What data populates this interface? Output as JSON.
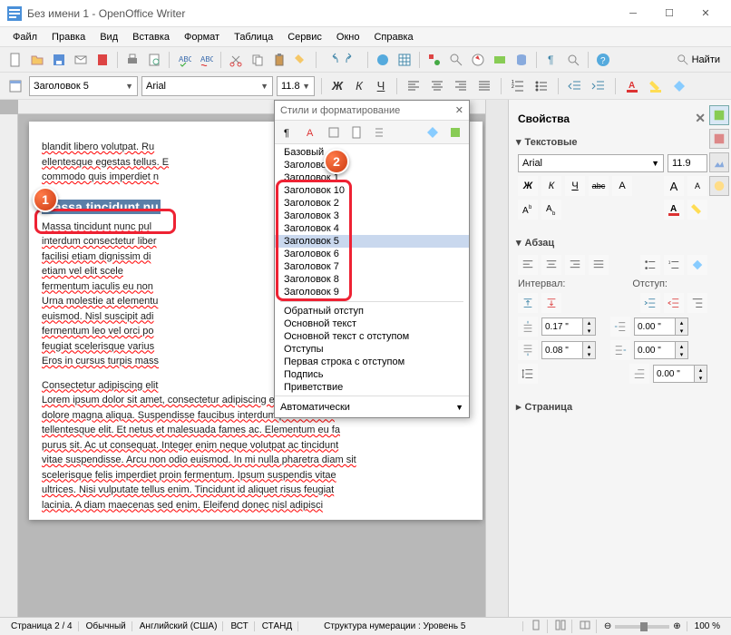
{
  "window": {
    "title": "Без имени 1 - OpenOffice Writer"
  },
  "menu": [
    "Файл",
    "Правка",
    "Вид",
    "Вставка",
    "Формат",
    "Таблица",
    "Сервис",
    "Окно",
    "Справка"
  ],
  "toolbar_find": "Найти",
  "formatbar": {
    "style": "Заголовок 5",
    "font": "Arial",
    "size": "11.8",
    "bold": "Ж",
    "italic": "К",
    "underline": "Ч"
  },
  "document": {
    "para1": "blandit libero volutpat. Ru",
    "para1b": "ellentesque egestas tellus. E",
    "para1c": "commodo quis imperdiet n",
    "heading_selected": "Massa tincidunt nu",
    "para2a": "Massa tincidunt nunc pul",
    "para2b": "interdum consectetur liber",
    "para2c": "facilisi etiam dignissim di",
    "para2d": "etiam vel elit scele",
    "para2e": "fermentum iaculis eu non",
    "para2f": "Urna molestie at elementu",
    "para2g": "euismod. Nisl suscipit adi",
    "para2h": "fermentum leo vel orci po",
    "para2i": "feugiat scelerisque varius",
    "para2j": "Eros in cursus turpis mass",
    "para3a": "Consectetur adipiscing elit",
    "para3b": "Lorem ipsum dolor sit amet, consectetur adipiscing elit, sed do elit",
    "para3c": "dolore magna aliqua. Suspendisse faucibus interdum posuere lore",
    "para3d": "tellentesque elit. Et netus et malesuada fames ac. Elementum eu fa",
    "para3e": "purus sit. Ac ut consequat. Integer enim neque volutpat ac tincidunt",
    "para3f": "vitae suspendisse. Arcu non odio euismod. In mi nulla pharetra diam sit",
    "para3g": "scelerisque felis imperdiet proin fermentum. Ipsum suspendis vitae",
    "para3h": "ultrices. Nisi vulputate tellus enim. Tincidunt id aliquet risus feugiat",
    "para3i": "lacinia. A diam maecenas sed enim. Eleifend donec nisl adipisci"
  },
  "styles_panel": {
    "title": "Стили и форматирование",
    "items_top": [
      "Базовый",
      "Заголовок",
      "Заголовок 1"
    ],
    "items_boxed": [
      "Заголовок 10",
      "Заголовок 2",
      "Заголовок 3",
      "Заголовок 4",
      "Заголовок 5",
      "Заголовок 6",
      "Заголовок 7",
      "Заголовок 8",
      "Заголовок 9"
    ],
    "selected_index": 4,
    "items_bottom": [
      "Обратный отступ",
      "Основной текст",
      "Основной текст с отступом",
      "Отступы",
      "Первая строка с отступом",
      "Подпись",
      "Приветствие"
    ],
    "footer": "Автоматически"
  },
  "sidebar": {
    "title": "Свойства",
    "section_text": "Текстовые",
    "font": "Arial",
    "size": "11.9",
    "bold": "Ж",
    "italic": "К",
    "underline": "Ч",
    "strike": "abc",
    "shadow": "A",
    "section_para": "Абзац",
    "interval_label": "Интервал:",
    "indent_label": "Отступ:",
    "above": "0.17 \"",
    "before": "0.00 \"",
    "below": "0.08 \"",
    "after": "0.00 \"",
    "firstline": "0.00 \"",
    "section_page": "Страница"
  },
  "statusbar": {
    "page": "Страница  2 / 4",
    "style": "Обычный",
    "lang": "Английский (США)",
    "ins": "ВСТ",
    "std": "СТАНД",
    "outline": "Структура нумерации : Уровень  5",
    "zoom": "100 %"
  },
  "markers": {
    "m1": "1",
    "m2": "2"
  }
}
